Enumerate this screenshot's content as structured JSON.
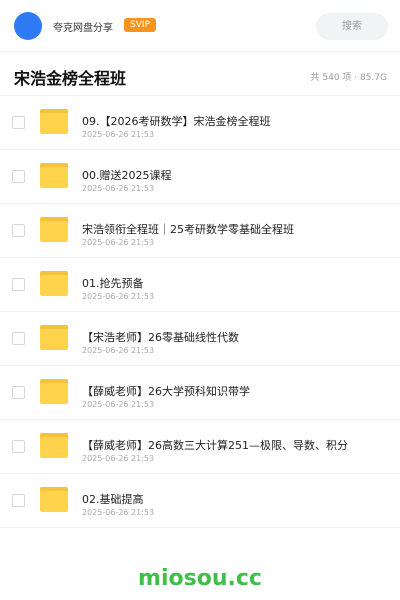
{
  "header": {
    "app_name": "夸克网盘分享",
    "badge": "SVIP",
    "search_placeholder": "搜索"
  },
  "folder": {
    "title": "宋浩金榜全程班",
    "meta": "共 540 项 · 85.7G"
  },
  "files": [
    {
      "name": "09.【2026考研数学】宋浩金榜全程班",
      "date": "2025-06-26 21:53"
    },
    {
      "name": "00.赠送2025课程",
      "date": "2025-06-26 21:53"
    },
    {
      "name": "宋浩领衔全程班｜25考研数学零基础全程班",
      "date": "2025-06-26 21:53"
    },
    {
      "name": "01.抢先预备",
      "date": "2025-06-26 21:53"
    },
    {
      "name": "【宋浩老师】26零基础线性代数",
      "date": "2025-06-26 21:53"
    },
    {
      "name": "【薛威老师】26大学预科知识带学",
      "date": "2025-06-26 21:53"
    },
    {
      "name": "【薛威老师】26高数三大计算251—极限、导数、积分",
      "date": "2025-06-26 21:53"
    },
    {
      "name": "02.基础提高",
      "date": "2025-06-26 21:53"
    }
  ],
  "watermark": "miosou.cc",
  "colors": {
    "avatar": "#2f7bf5",
    "badge": "#f7941e",
    "folder": "#ffd34c",
    "watermark": "#3fbf4a"
  }
}
